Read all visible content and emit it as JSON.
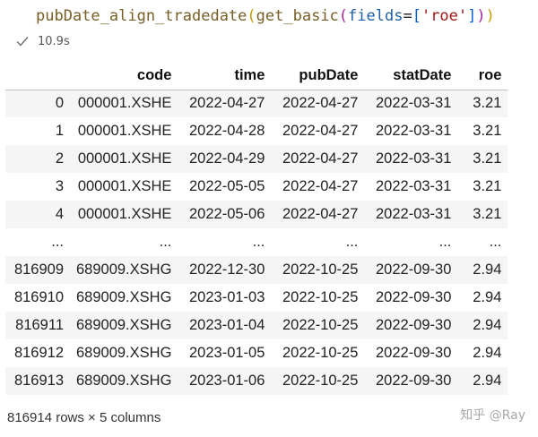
{
  "cell": {
    "code_tokens": {
      "fn_outer": "pubDate_align_tradedate",
      "paren_open_1": "(",
      "fn_inner": "get_basic",
      "paren_open_2": "(",
      "kwarg": "fields",
      "eq": "=",
      "bracket_open": "[",
      "string": "'roe'",
      "bracket_close": "]",
      "paren_close_2": ")",
      "paren_close_1": ")"
    },
    "exec_time": "10.9s",
    "status_icon": "check-icon"
  },
  "dataframe": {
    "columns": [
      "",
      "code",
      "time",
      "pubDate",
      "statDate",
      "roe"
    ],
    "rows": [
      [
        "0",
        "000001.XSHE",
        "2022-04-27",
        "2022-04-27",
        "2022-03-31",
        "3.21"
      ],
      [
        "1",
        "000001.XSHE",
        "2022-04-28",
        "2022-04-27",
        "2022-03-31",
        "3.21"
      ],
      [
        "2",
        "000001.XSHE",
        "2022-04-29",
        "2022-04-27",
        "2022-03-31",
        "3.21"
      ],
      [
        "3",
        "000001.XSHE",
        "2022-05-05",
        "2022-04-27",
        "2022-03-31",
        "3.21"
      ],
      [
        "4",
        "000001.XSHE",
        "2022-05-06",
        "2022-04-27",
        "2022-03-31",
        "3.21"
      ],
      [
        "...",
        "...",
        "...",
        "...",
        "...",
        "..."
      ],
      [
        "816909",
        "689009.XSHG",
        "2022-12-30",
        "2022-10-25",
        "2022-09-30",
        "2.94"
      ],
      [
        "816910",
        "689009.XSHG",
        "2023-01-03",
        "2022-10-25",
        "2022-09-30",
        "2.94"
      ],
      [
        "816911",
        "689009.XSHG",
        "2023-01-04",
        "2022-10-25",
        "2022-09-30",
        "2.94"
      ],
      [
        "816912",
        "689009.XSHG",
        "2023-01-05",
        "2022-10-25",
        "2022-09-30",
        "2.94"
      ],
      [
        "816913",
        "689009.XSHG",
        "2023-01-06",
        "2022-10-25",
        "2022-09-30",
        "2.94"
      ]
    ],
    "shape_text": "816914 rows × 5 columns"
  },
  "watermark": "知乎 @Ray"
}
